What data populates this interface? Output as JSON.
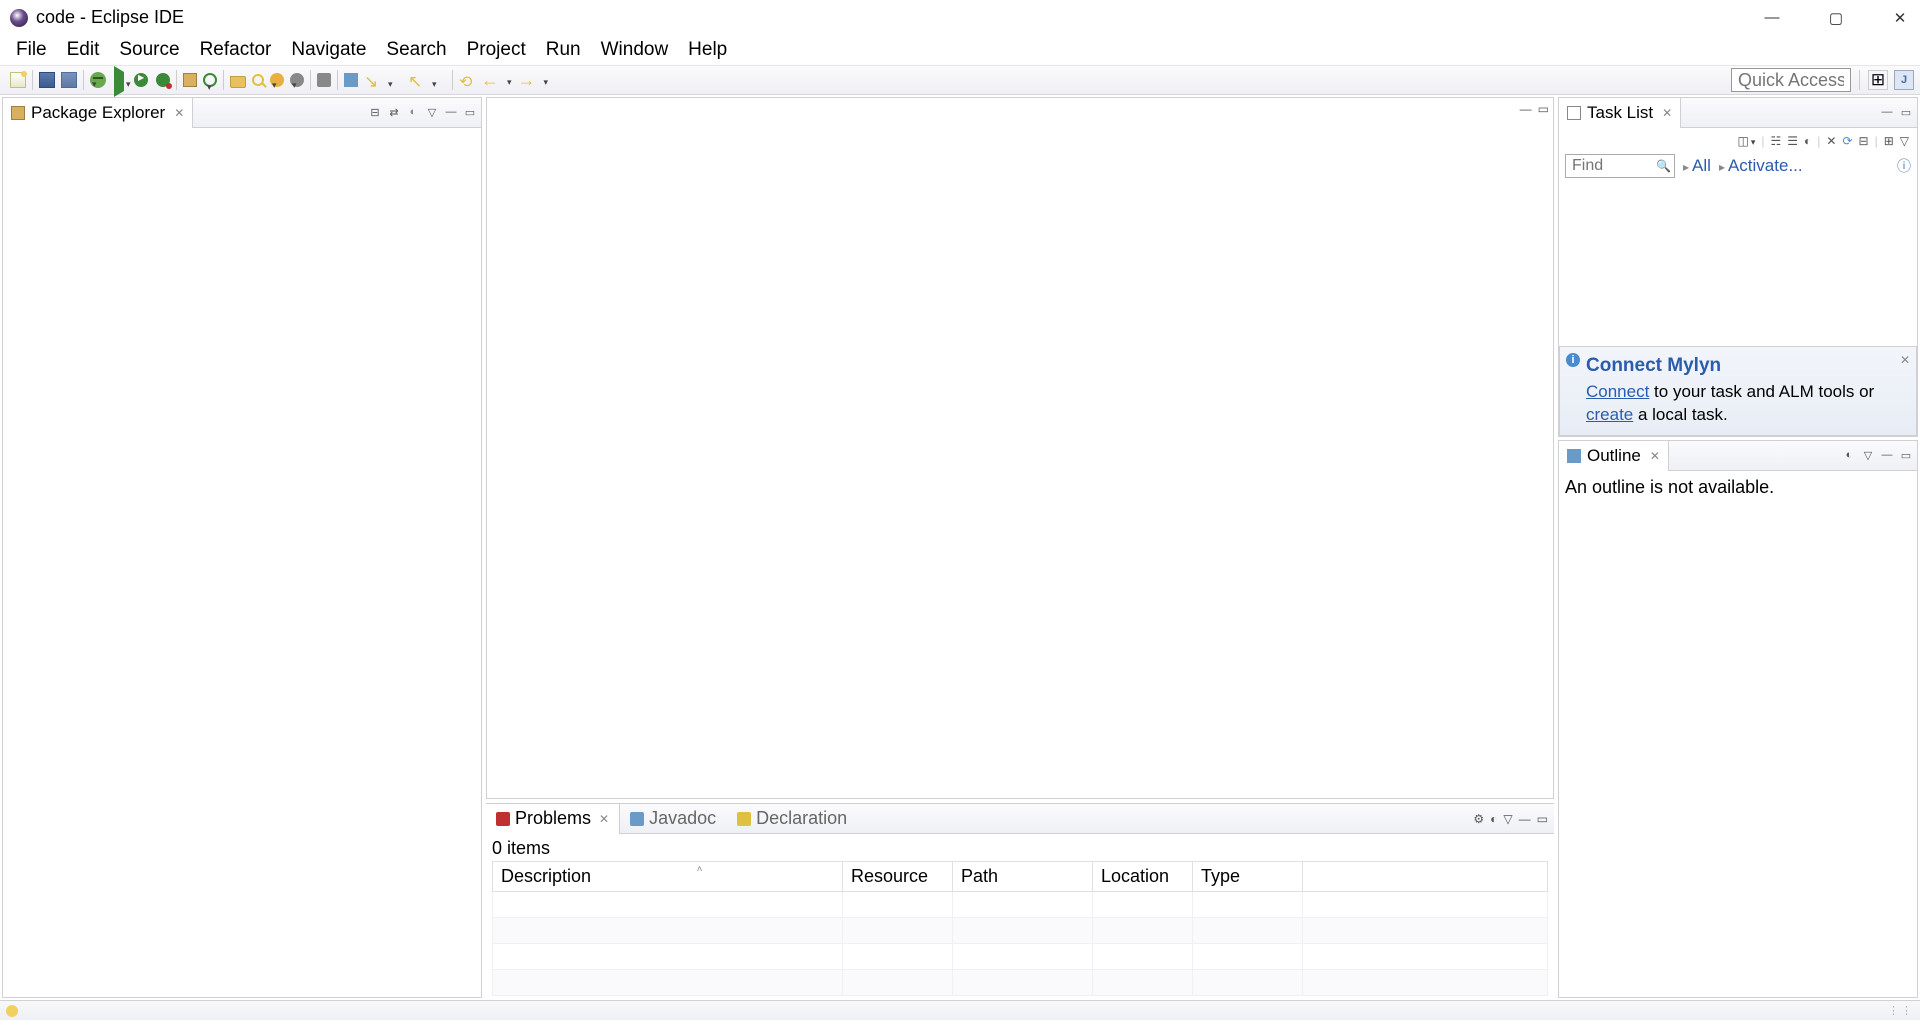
{
  "window": {
    "title": "code - Eclipse IDE"
  },
  "menu": {
    "items": [
      "File",
      "Edit",
      "Source",
      "Refactor",
      "Navigate",
      "Search",
      "Project",
      "Run",
      "Window",
      "Help"
    ]
  },
  "toolbar": {
    "quick_access_placeholder": "Quick Access"
  },
  "views": {
    "package_explorer": {
      "title": "Package Explorer"
    },
    "task_list": {
      "title": "Task List",
      "find_placeholder": "Find",
      "all_label": "All",
      "activate_label": "Activate..."
    },
    "mylyn": {
      "heading": "Connect Mylyn",
      "connect_label": "Connect",
      "text_mid": " to your task and ALM tools or ",
      "create_label": "create",
      "text_end": " a local task."
    },
    "outline": {
      "title": "Outline",
      "empty_text": "An outline is not available."
    }
  },
  "bottom": {
    "tabs": {
      "problems": "Problems",
      "javadoc": "Javadoc",
      "declaration": "Declaration"
    },
    "problems": {
      "count_label": "0 items",
      "columns": [
        "Description",
        "Resource",
        "Path",
        "Location",
        "Type"
      ]
    }
  }
}
